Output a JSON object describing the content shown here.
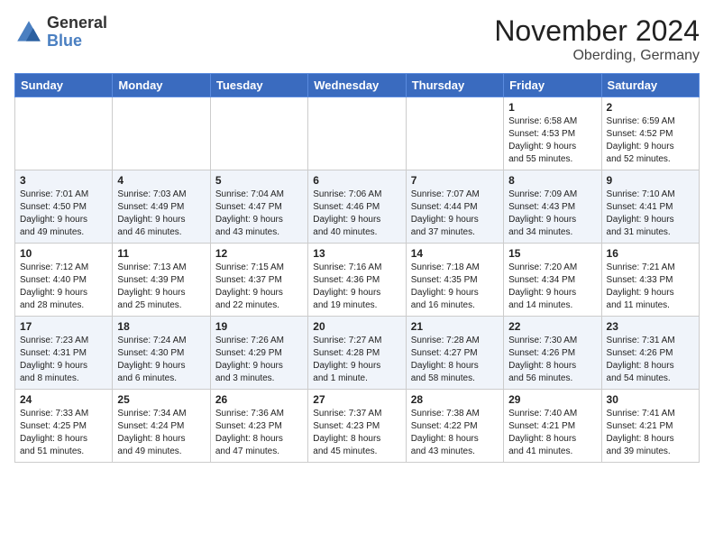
{
  "logo": {
    "line1": "General",
    "line2": "Blue"
  },
  "title": "November 2024",
  "subtitle": "Oberding, Germany",
  "days_header": [
    "Sunday",
    "Monday",
    "Tuesday",
    "Wednesday",
    "Thursday",
    "Friday",
    "Saturday"
  ],
  "weeks": [
    [
      {
        "day": "",
        "info": ""
      },
      {
        "day": "",
        "info": ""
      },
      {
        "day": "",
        "info": ""
      },
      {
        "day": "",
        "info": ""
      },
      {
        "day": "",
        "info": ""
      },
      {
        "day": "1",
        "info": "Sunrise: 6:58 AM\nSunset: 4:53 PM\nDaylight: 9 hours\nand 55 minutes."
      },
      {
        "day": "2",
        "info": "Sunrise: 6:59 AM\nSunset: 4:52 PM\nDaylight: 9 hours\nand 52 minutes."
      }
    ],
    [
      {
        "day": "3",
        "info": "Sunrise: 7:01 AM\nSunset: 4:50 PM\nDaylight: 9 hours\nand 49 minutes."
      },
      {
        "day": "4",
        "info": "Sunrise: 7:03 AM\nSunset: 4:49 PM\nDaylight: 9 hours\nand 46 minutes."
      },
      {
        "day": "5",
        "info": "Sunrise: 7:04 AM\nSunset: 4:47 PM\nDaylight: 9 hours\nand 43 minutes."
      },
      {
        "day": "6",
        "info": "Sunrise: 7:06 AM\nSunset: 4:46 PM\nDaylight: 9 hours\nand 40 minutes."
      },
      {
        "day": "7",
        "info": "Sunrise: 7:07 AM\nSunset: 4:44 PM\nDaylight: 9 hours\nand 37 minutes."
      },
      {
        "day": "8",
        "info": "Sunrise: 7:09 AM\nSunset: 4:43 PM\nDaylight: 9 hours\nand 34 minutes."
      },
      {
        "day": "9",
        "info": "Sunrise: 7:10 AM\nSunset: 4:41 PM\nDaylight: 9 hours\nand 31 minutes."
      }
    ],
    [
      {
        "day": "10",
        "info": "Sunrise: 7:12 AM\nSunset: 4:40 PM\nDaylight: 9 hours\nand 28 minutes."
      },
      {
        "day": "11",
        "info": "Sunrise: 7:13 AM\nSunset: 4:39 PM\nDaylight: 9 hours\nand 25 minutes."
      },
      {
        "day": "12",
        "info": "Sunrise: 7:15 AM\nSunset: 4:37 PM\nDaylight: 9 hours\nand 22 minutes."
      },
      {
        "day": "13",
        "info": "Sunrise: 7:16 AM\nSunset: 4:36 PM\nDaylight: 9 hours\nand 19 minutes."
      },
      {
        "day": "14",
        "info": "Sunrise: 7:18 AM\nSunset: 4:35 PM\nDaylight: 9 hours\nand 16 minutes."
      },
      {
        "day": "15",
        "info": "Sunrise: 7:20 AM\nSunset: 4:34 PM\nDaylight: 9 hours\nand 14 minutes."
      },
      {
        "day": "16",
        "info": "Sunrise: 7:21 AM\nSunset: 4:33 PM\nDaylight: 9 hours\nand 11 minutes."
      }
    ],
    [
      {
        "day": "17",
        "info": "Sunrise: 7:23 AM\nSunset: 4:31 PM\nDaylight: 9 hours\nand 8 minutes."
      },
      {
        "day": "18",
        "info": "Sunrise: 7:24 AM\nSunset: 4:30 PM\nDaylight: 9 hours\nand 6 minutes."
      },
      {
        "day": "19",
        "info": "Sunrise: 7:26 AM\nSunset: 4:29 PM\nDaylight: 9 hours\nand 3 minutes."
      },
      {
        "day": "20",
        "info": "Sunrise: 7:27 AM\nSunset: 4:28 PM\nDaylight: 9 hours\nand 1 minute."
      },
      {
        "day": "21",
        "info": "Sunrise: 7:28 AM\nSunset: 4:27 PM\nDaylight: 8 hours\nand 58 minutes."
      },
      {
        "day": "22",
        "info": "Sunrise: 7:30 AM\nSunset: 4:26 PM\nDaylight: 8 hours\nand 56 minutes."
      },
      {
        "day": "23",
        "info": "Sunrise: 7:31 AM\nSunset: 4:26 PM\nDaylight: 8 hours\nand 54 minutes."
      }
    ],
    [
      {
        "day": "24",
        "info": "Sunrise: 7:33 AM\nSunset: 4:25 PM\nDaylight: 8 hours\nand 51 minutes."
      },
      {
        "day": "25",
        "info": "Sunrise: 7:34 AM\nSunset: 4:24 PM\nDaylight: 8 hours\nand 49 minutes."
      },
      {
        "day": "26",
        "info": "Sunrise: 7:36 AM\nSunset: 4:23 PM\nDaylight: 8 hours\nand 47 minutes."
      },
      {
        "day": "27",
        "info": "Sunrise: 7:37 AM\nSunset: 4:23 PM\nDaylight: 8 hours\nand 45 minutes."
      },
      {
        "day": "28",
        "info": "Sunrise: 7:38 AM\nSunset: 4:22 PM\nDaylight: 8 hours\nand 43 minutes."
      },
      {
        "day": "29",
        "info": "Sunrise: 7:40 AM\nSunset: 4:21 PM\nDaylight: 8 hours\nand 41 minutes."
      },
      {
        "day": "30",
        "info": "Sunrise: 7:41 AM\nSunset: 4:21 PM\nDaylight: 8 hours\nand 39 minutes."
      }
    ]
  ]
}
